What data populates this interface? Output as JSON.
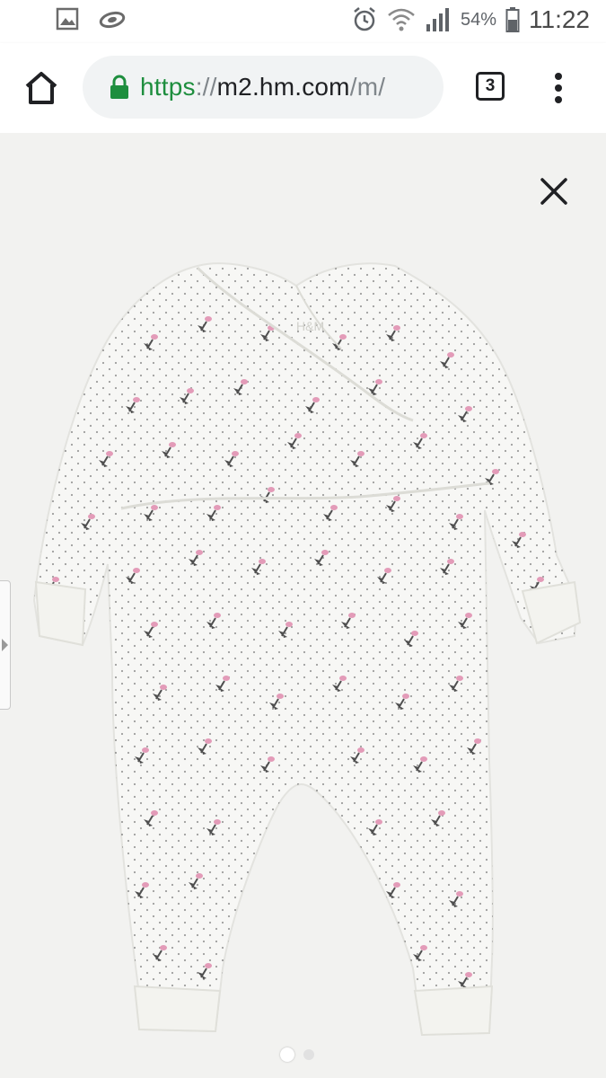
{
  "status_bar": {
    "left_icons": [
      "image-icon",
      "cloud-sync-icon"
    ],
    "right_icons": [
      "alarm-icon",
      "wifi-icon",
      "signal-icon"
    ],
    "battery_percent": "54%",
    "time": "11:22"
  },
  "browser": {
    "url": {
      "scheme": "https",
      "separator": "://",
      "host": "m2.hm.com",
      "path": "/m/"
    },
    "tab_count": "3",
    "icons": {
      "home": "home-icon",
      "lock": "lock-icon",
      "menu": "more-vert-icon"
    }
  },
  "viewer": {
    "image": "baby-romper-floral-print",
    "close_icon": "close-icon",
    "pager": {
      "total": 2,
      "active_index": 0
    },
    "colors": {
      "background": "#f2f2f0",
      "fabric": "#f7f7f5",
      "flower": "#e39bb8",
      "leaf": "#4f4f4f"
    }
  }
}
